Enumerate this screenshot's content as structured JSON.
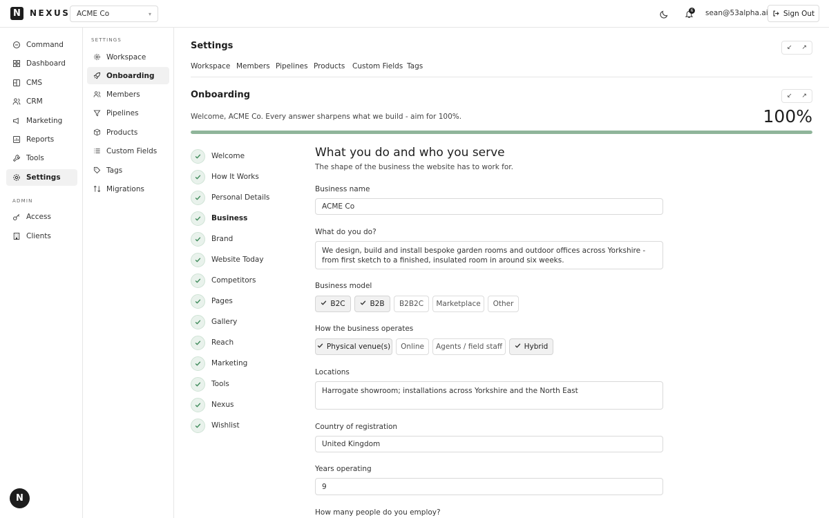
{
  "app": {
    "logo_letter": "N",
    "logo_text": "NEXUS"
  },
  "topbar": {
    "org": "ACME Co",
    "notifications": "6",
    "user_email": "sean@53alpha.ai",
    "sign_out": "Sign Out"
  },
  "nav": {
    "items": [
      "Command",
      "Dashboard",
      "CMS",
      "CRM",
      "Marketing",
      "Reports",
      "Tools",
      "Settings"
    ],
    "active": "Settings",
    "admin_label": "ADMIN",
    "admin_items": [
      "Access",
      "Clients"
    ]
  },
  "fab_letter": "N",
  "subnav": {
    "title": "SETTINGS",
    "items": [
      "Workspace",
      "Onboarding",
      "Members",
      "Pipelines",
      "Products",
      "Custom Fields",
      "Tags",
      "Migrations"
    ]
  },
  "page": {
    "title": "Settings",
    "tabs": [
      "Workspace",
      "Members",
      "Pipelines",
      "Products",
      "Custom Fields",
      "Tags"
    ]
  },
  "onboarding": {
    "title": "Onboarding",
    "welcome": "Welcome, ACME Co. Every answer sharpens what we build - aim for 100%.",
    "percent_label": "100%",
    "progress": 1.0,
    "steps": [
      "Welcome",
      "How It Works",
      "Personal Details",
      "Business",
      "Brand",
      "Website Today",
      "Competitors",
      "Pages",
      "Gallery",
      "Reach",
      "Marketing",
      "Tools",
      "Nexus",
      "Wishlist"
    ],
    "active_step": "Business"
  },
  "form": {
    "heading": "What you do and who you serve",
    "subheading": "The shape of the business the website has to work for.",
    "business_name_label": "Business name",
    "business_name_value": "ACME Co",
    "what_do_label": "What do you do?",
    "what_do_value": "We design, build and install bespoke garden rooms and outdoor offices across Yorkshire - from first sketch to a finished, insulated room in around six weeks.",
    "model_label": "Business model",
    "model_options": [
      {
        "label": "B2C",
        "selected": true
      },
      {
        "label": "B2B",
        "selected": true
      },
      {
        "label": "B2B2C",
        "selected": false
      },
      {
        "label": "Marketplace",
        "selected": false
      },
      {
        "label": "Other",
        "selected": false
      }
    ],
    "operates_label": "How the business operates",
    "operates_options": [
      {
        "label": "Physical venue(s)",
        "selected": true
      },
      {
        "label": "Online",
        "selected": false
      },
      {
        "label": "Agents / field staff",
        "selected": false
      },
      {
        "label": "Hybrid",
        "selected": true
      }
    ],
    "locations_label": "Locations",
    "locations_value": "Harrogate showroom; installations across Yorkshire and the North East",
    "country_label": "Country of registration",
    "country_value": "United Kingdom",
    "years_label": "Years operating",
    "years_value": "9",
    "employ_label": "How many people do you employ?"
  },
  "colors": {
    "progress": "#8fb59a",
    "check": "#3f8a5a",
    "dark": "#1d1d1d"
  }
}
